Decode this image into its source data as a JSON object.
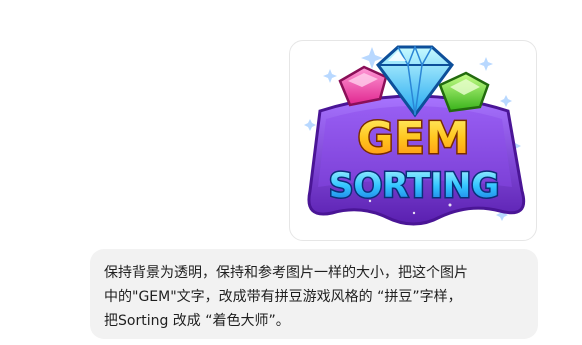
{
  "message": {
    "image": {
      "logo_line1": "GEM",
      "logo_line2": "SORTING",
      "colors": {
        "gem_left": "#ff4fb3",
        "gem_center": "#35d4ff",
        "gem_right": "#6ee043",
        "badge_purple": "#7b3fd8",
        "gem_text": "#ffb21a",
        "sorting_text": "#33c6ff"
      }
    },
    "text_lines": [
      "保持背景为透明，保持和参考图片一样的大小，把这个图片",
      "中的\"GEM\"文字，改成带有拼豆游戏风格的 “拼豆”字样，",
      "把Sorting 改成 “着色大师”。"
    ]
  }
}
